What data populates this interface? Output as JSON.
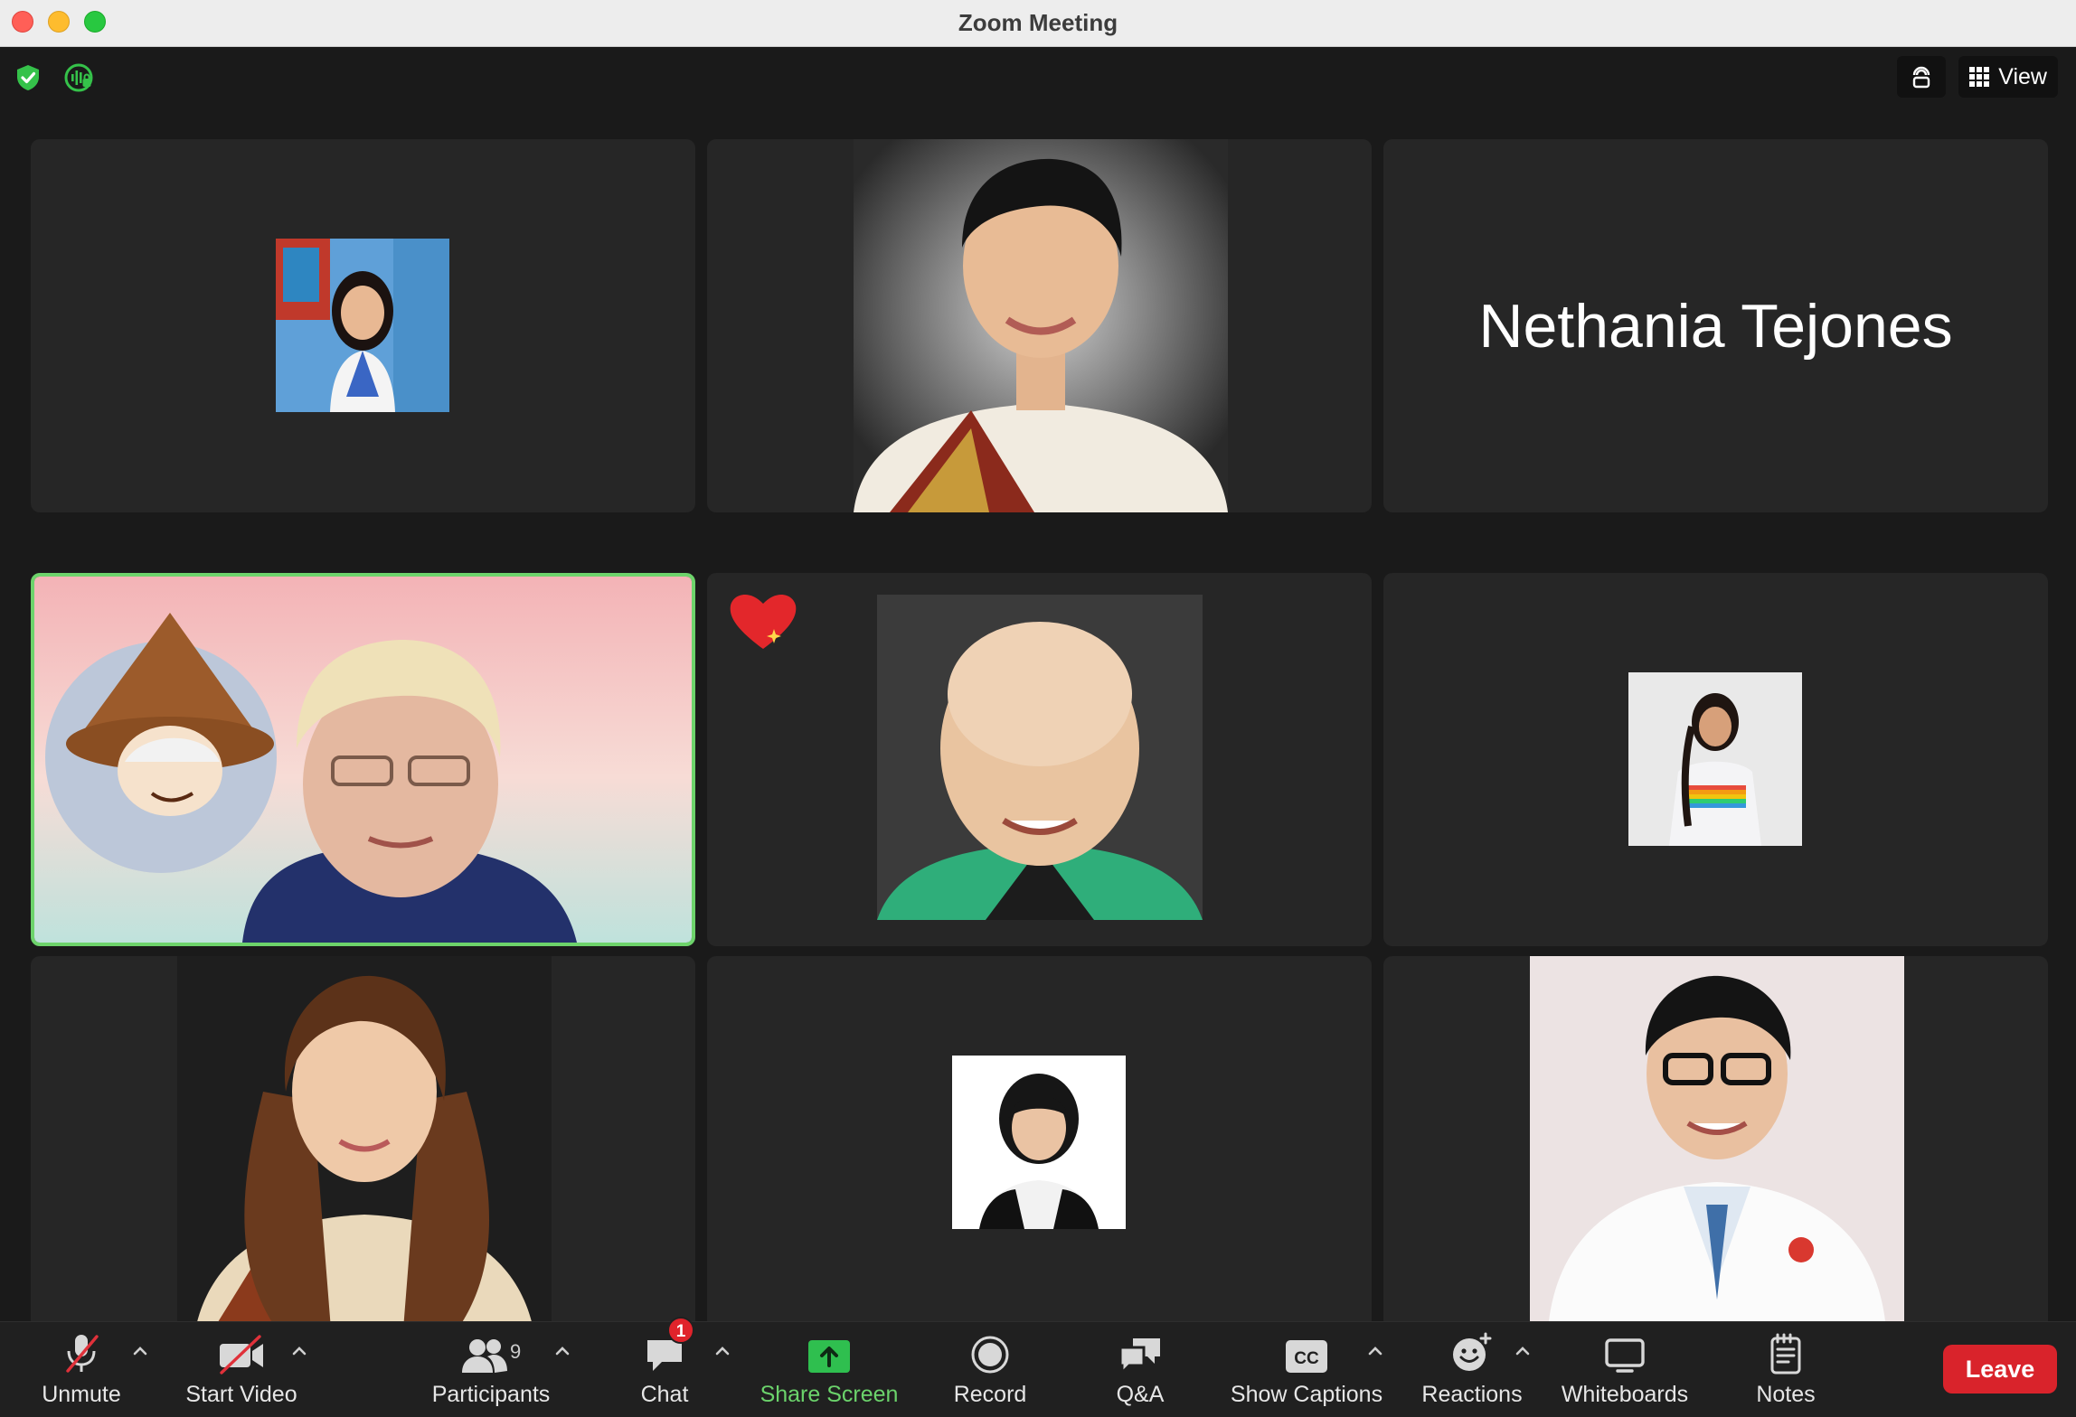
{
  "window": {
    "title": "Zoom Meeting"
  },
  "top_right": {
    "view_label": "View"
  },
  "tiles": {
    "name_tile": "Nethania Tejones"
  },
  "toolbar": {
    "unmute": "Unmute",
    "start_video": "Start Video",
    "participants": "Participants",
    "participant_count": "9",
    "chat": "Chat",
    "chat_badge": "1",
    "share_screen": "Share Screen",
    "record": "Record",
    "qa": "Q&A",
    "show_captions": "Show Captions",
    "cc_icon_text": "CC",
    "reactions": "Reactions",
    "whiteboards": "Whiteboards",
    "notes": "Notes",
    "leave": "Leave"
  },
  "colors": {
    "accent_green": "#6dd36b",
    "leave_red": "#d9232b",
    "tile_bg": "#262626",
    "stage_bg": "#1a1a1a"
  }
}
